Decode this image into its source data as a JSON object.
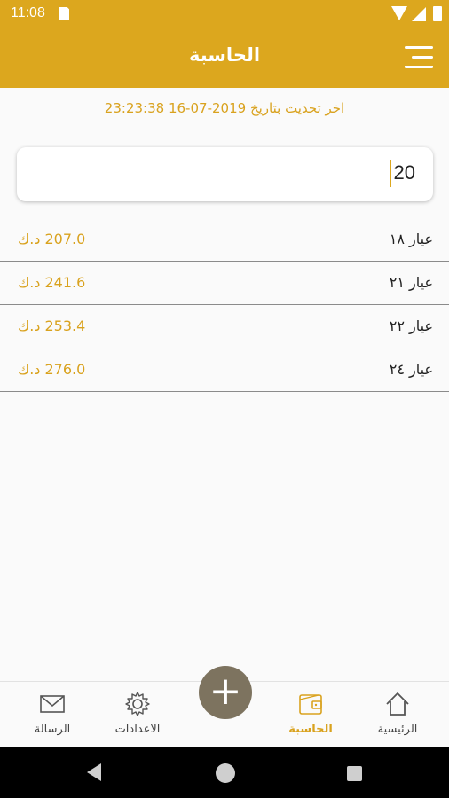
{
  "status_bar": {
    "time": "11:08"
  },
  "app_bar": {
    "title": "الحاسبة"
  },
  "last_update": "اخر تحديث بتاريخ 2019-07-16 23:23:38",
  "calculator": {
    "amount": "20"
  },
  "karats": [
    {
      "name": "عيار ١٨",
      "price": "207.0 د.ك"
    },
    {
      "name": "عيار ٢١",
      "price": "241.6 د.ك"
    },
    {
      "name": "عيار ٢٢",
      "price": "253.4 د.ك"
    },
    {
      "name": "عيار ٢٤",
      "price": "276.0 د.ك"
    }
  ],
  "bottom_nav": {
    "home": "الرئيسية",
    "calculator": "الحاسبة",
    "settings": "الاعدادات",
    "message": "الرسالة",
    "fab": "+"
  },
  "colors": {
    "accent": "#dca71e",
    "fab": "#7d735f",
    "price": "#d9a21e"
  }
}
